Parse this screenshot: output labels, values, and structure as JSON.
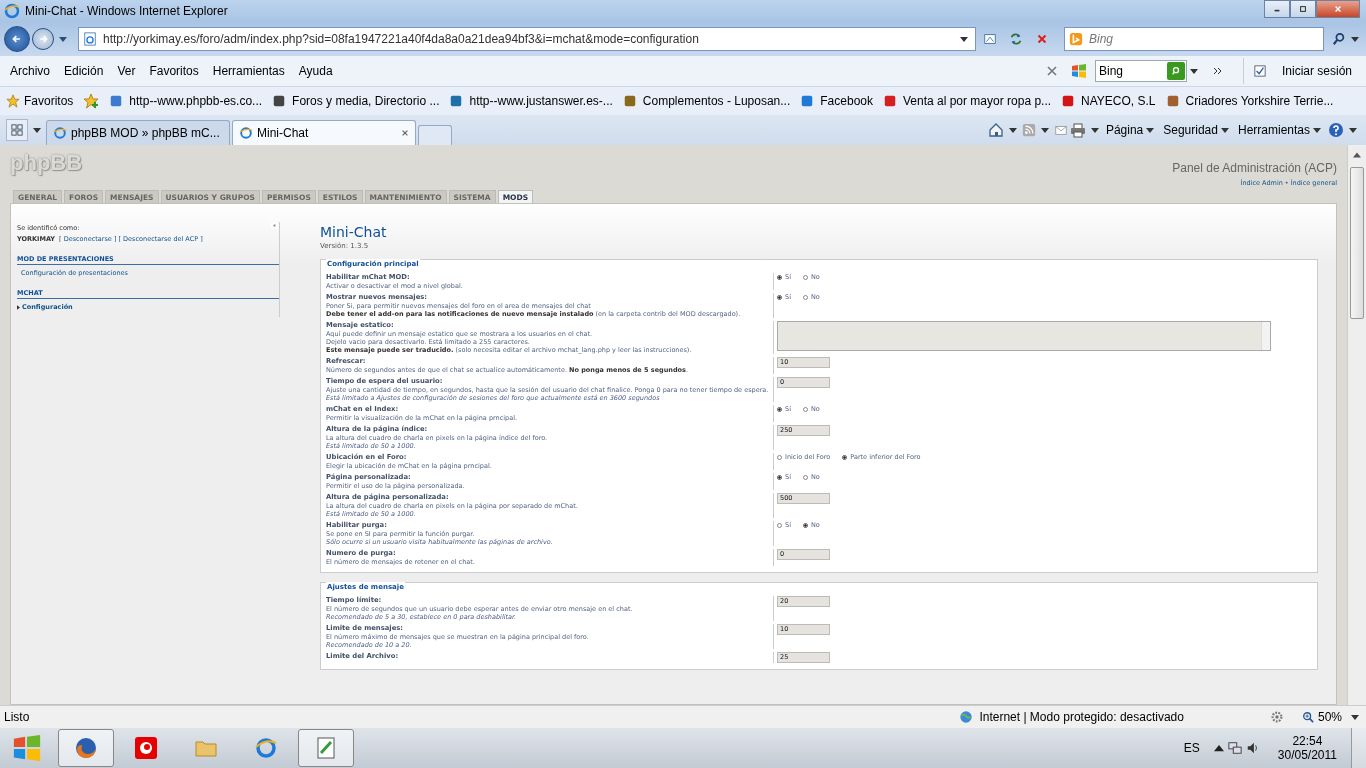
{
  "window": {
    "title": "Mini-Chat - Windows Internet Explorer"
  },
  "address_bar": {
    "url": "http://yorkimay.es/foro/adm/index.php?sid=08fa1947221a40f4da8a0a21dea94bf3&i=mchat&mode=configuration",
    "search_placeholder": "Bing"
  },
  "menu": [
    "Archivo",
    "Edición",
    "Ver",
    "Favoritos",
    "Herramientas",
    "Ayuda"
  ],
  "toolbar": {
    "search_value": "Bing",
    "signin": "Iniciar sesión"
  },
  "favorites": {
    "label": "Favoritos",
    "links": [
      "http--www.phpbb-es.co...",
      "Foros y media, Directorio ...",
      "http--www.justanswer.es-...",
      "Complementos - Luposan...",
      "Facebook",
      "Venta al por mayor ropa p...",
      "NAYECO, S.L",
      "Criadores Yorkshire Terrie..."
    ]
  },
  "tabs": [
    {
      "label": "phpBB MOD » phpBB mC...",
      "selected": false
    },
    {
      "label": "Mini-Chat",
      "selected": true
    }
  ],
  "commands": [
    "Página",
    "Seguridad",
    "Herramientas"
  ],
  "page": {
    "logo": "phpBB",
    "acp_title": "Panel de Administración (ACP)",
    "breadcrumb": [
      "Índice Admin",
      "Índice general"
    ],
    "breadcrumb_separator": "•",
    "acp_tabs": [
      {
        "label": "GENERAL",
        "selected": false
      },
      {
        "label": "FOROS",
        "selected": false
      },
      {
        "label": "MENSAJES",
        "selected": false
      },
      {
        "label": "USUARIOS Y GRUPOS",
        "selected": false
      },
      {
        "label": "PERMISOS",
        "selected": false
      },
      {
        "label": "ESTILOS",
        "selected": false
      },
      {
        "label": "MANTENIMIENTO",
        "selected": false
      },
      {
        "label": "SISTEMA",
        "selected": false
      },
      {
        "label": "MODS",
        "selected": true
      }
    ],
    "sidebar": {
      "logged_as": "Se identificó como:",
      "user": "YORKIMAY",
      "links": [
        "[ Desconectarse ]",
        "[ Desconectarse del ACP ]"
      ],
      "sections": [
        {
          "title": "MOD DE PRESENTACIONES",
          "items": [
            {
              "label": "Configuración de presentaciones",
              "selected": false
            }
          ]
        },
        {
          "title": "MCHAT",
          "items": [
            {
              "label": "Configuración",
              "selected": true
            }
          ]
        }
      ]
    },
    "title": "Mini-Chat",
    "version": "Versión: 1.3.5",
    "fieldsets": [
      {
        "legend": "Configuración principal",
        "options": [
          {
            "kind": "radio",
            "title": "Habilitar mChat MOD:",
            "description": [
              "Activar o desactivar el mod a nivel global."
            ],
            "choices": [
              {
                "label": "Sí",
                "selected": true
              },
              {
                "label": "No",
                "selected": false
              }
            ]
          },
          {
            "kind": "radio",
            "title": "Mostrar nuevos mensajes:",
            "description": [
              "Poner Si, para permitir nuevos mensajes del foro en el area de mensajes del chat",
              "**Debe tener el add-on para las notificaciones de nuevo mensaje instalado** (en la carpeta contrib del MOD descargado)."
            ],
            "choices": [
              {
                "label": "Sí",
                "selected": true
              },
              {
                "label": "No",
                "selected": false
              }
            ]
          },
          {
            "kind": "textarea",
            "title": "Mensaje estatico:",
            "description": [
              "Aquí puede definir un mensaje estatico que se mostrara a los usuarios en el chat.",
              "Dejelo vacio para desactivarlo. Está limitado a 255 caracteres.",
              "**Este mensaje puede ser traducido.** (solo necesita editar el archivo mchat_lang.php y leer las instrucciones)."
            ]
          },
          {
            "kind": "text",
            "title": "Refrescar:",
            "description": [
              "Número de segundos antes de que el chat se actualice automáticamente. **No ponga menos de 5 segundos**."
            ],
            "value": "10"
          },
          {
            "kind": "text",
            "title": "Tiempo de espera del usuario:",
            "description": [
              "Ajuste una cantidad de tiempo, en segundos, hasta que la sesión del usuario del chat finalice. Ponga 0 para no tener tiempo de espera."
            ],
            "note": "Está limitado a Ajustes de configuración de sesiones del foro que actualmente está en 3600 segundos",
            "value": "0"
          },
          {
            "kind": "radio",
            "title": "mChat en el Index:",
            "description": [
              "Permitir la visualización de la mChat en la página prncipal."
            ],
            "choices": [
              {
                "label": "Sí",
                "selected": true
              },
              {
                "label": "No",
                "selected": false
              }
            ]
          },
          {
            "kind": "text",
            "title": "Altura de la página índice:",
            "description": [
              "La altura del cuadro de charla en pixels en la página índice del foro."
            ],
            "note": "Está limitado de 50 a 1000.",
            "value": "250"
          },
          {
            "kind": "radio",
            "title": "Ubicación en el Foro:",
            "description": [
              "Elegir la ubicación de mChat en la página prncipal."
            ],
            "choices": [
              {
                "label": "Inicio del Foro",
                "selected": false
              },
              {
                "label": "Parte inferior del Foro",
                "selected": true
              }
            ]
          },
          {
            "kind": "radio",
            "title": "Página personalizada:",
            "description": [
              "Permitir el uso de la página personalizada."
            ],
            "choices": [
              {
                "label": "Sí",
                "selected": true
              },
              {
                "label": "No",
                "selected": false
              }
            ]
          },
          {
            "kind": "text",
            "title": "Altura de página personalizada:",
            "description": [
              "La altura del cuadro de charla en pixels en la página por separado de mChat."
            ],
            "note": "Está limitado de 50 a 1000.",
            "value": "500"
          },
          {
            "kind": "radio",
            "title": "Habilitar purga:",
            "description": [
              "Se pone en SI para permitir la función purgar."
            ],
            "note": "Sólo ocurre si un usuario visita habitualmente las páginas de archivo.",
            "choices": [
              {
                "label": "Sí",
                "selected": false
              },
              {
                "label": "No",
                "selected": true
              }
            ]
          },
          {
            "kind": "text",
            "title": "Numero de purga:",
            "description": [
              "El número de mensajes de retener en el chat."
            ],
            "value": "0"
          }
        ]
      },
      {
        "legend": "Ajustes de mensaje",
        "options": [
          {
            "kind": "text",
            "title": "Tiempo límite:",
            "description": [
              "El número de segundos que un usuario debe esperar antes de enviar otro mensaje en el chat."
            ],
            "note": "Recomendado de 5 a 30, establece en 0 para deshabilitar.",
            "value": "20"
          },
          {
            "kind": "text",
            "title": "Limite de mensajes:",
            "description": [
              "El número máximo de mensajes que se muestran en la página principal del foro."
            ],
            "note": "Recomendado de 10 a 20.",
            "value": "10"
          },
          {
            "kind": "text",
            "title": "Limite del Archivo:",
            "value": "25"
          }
        ]
      }
    ]
  },
  "status_bar": {
    "text": "Listo",
    "zone": "Internet | Modo protegido: desactivado",
    "zoom": "50%"
  },
  "taskbar": {
    "language": "ES",
    "time": "22:54",
    "date": "30/05/2011"
  }
}
